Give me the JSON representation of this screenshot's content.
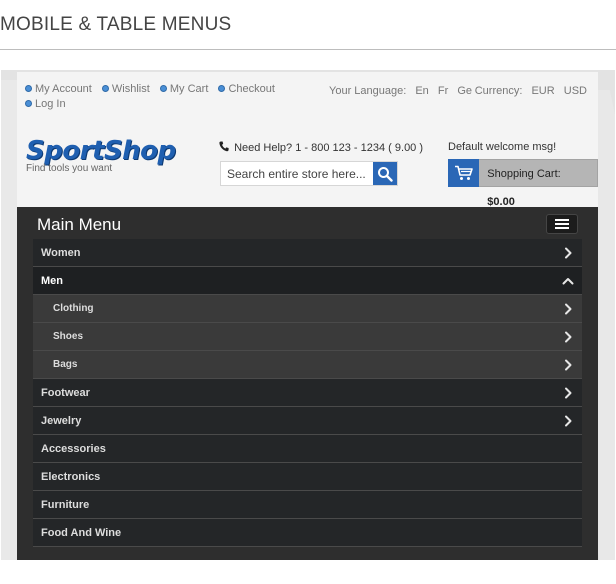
{
  "page": {
    "heading": "MOBILE & TABLE MENUS"
  },
  "header": {
    "links_row1": [
      {
        "label": "My Account"
      },
      {
        "label": "Wishlist"
      },
      {
        "label": "My Cart"
      },
      {
        "label": "Checkout"
      }
    ],
    "links_row2": [
      {
        "label": "Log In"
      }
    ],
    "language": {
      "label": "Your Language:",
      "options": [
        "En",
        "Fr",
        "Ge"
      ]
    },
    "currency": {
      "label": "Currency:",
      "options": [
        "EUR",
        "USD"
      ]
    },
    "logo": {
      "text": "SportShop",
      "tagline": "Find tools you want"
    },
    "help_text": "Need Help? 1 - 800 123 - 1234 ( 9.00 )",
    "search": {
      "placeholder": "Search entire store here..."
    },
    "welcome": "Default welcome msg!",
    "cart": {
      "label": "Shopping Cart:",
      "amount": "$0.00"
    }
  },
  "menu": {
    "title": "Main Menu",
    "items": [
      {
        "label": "Women",
        "level": 0,
        "arrow": "right"
      },
      {
        "label": "Men",
        "level": 0,
        "arrow": "up",
        "active": true
      },
      {
        "label": "Clothing",
        "level": 1,
        "arrow": "right"
      },
      {
        "label": "Shoes",
        "level": 1,
        "arrow": "right"
      },
      {
        "label": "Bags",
        "level": 1,
        "arrow": "right"
      },
      {
        "label": "Footwear",
        "level": 0,
        "arrow": "right"
      },
      {
        "label": "Jewelry",
        "level": 0,
        "arrow": "right"
      },
      {
        "label": "Accessories",
        "level": 0,
        "arrow": "none"
      },
      {
        "label": "Electronics",
        "level": 0,
        "arrow": "none"
      },
      {
        "label": "Furniture",
        "level": 0,
        "arrow": "none"
      },
      {
        "label": "Food And Wine",
        "level": 0,
        "arrow": "none"
      }
    ]
  },
  "colors": {
    "brand_blue": "#2a67b6",
    "menu_bg": "#242628",
    "submenu_bg": "#3a3a3a"
  }
}
